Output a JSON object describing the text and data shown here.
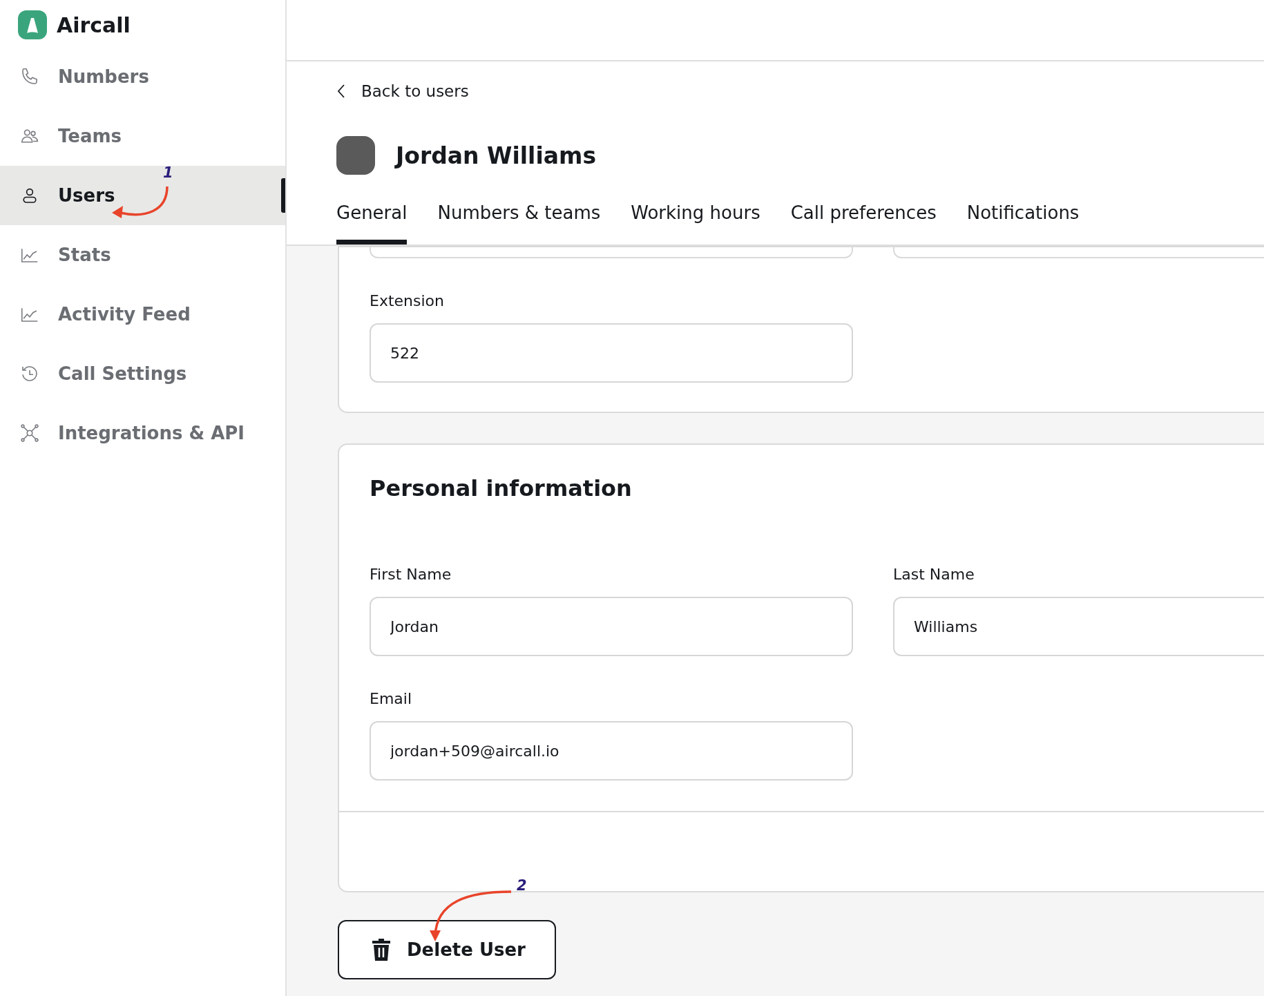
{
  "sidebar": {
    "brand": "Aircall",
    "items": [
      {
        "label": "Numbers",
        "selected": false
      },
      {
        "label": "Teams",
        "selected": false
      },
      {
        "label": "Users",
        "selected": true
      },
      {
        "label": "Stats",
        "selected": false
      },
      {
        "label": "Activity Feed",
        "selected": false
      },
      {
        "label": "Call Settings",
        "selected": false
      },
      {
        "label": "Integrations & API",
        "selected": false
      }
    ]
  },
  "back_link": "Back to users",
  "user": {
    "name": "Jordan Williams"
  },
  "tabs": [
    {
      "label": "General",
      "selected": true
    },
    {
      "label": "Numbers & teams",
      "selected": false
    },
    {
      "label": "Working hours",
      "selected": false
    },
    {
      "label": "Call preferences",
      "selected": false
    },
    {
      "label": "Notifications",
      "selected": false
    }
  ],
  "extension": {
    "label": "Extension",
    "value": "522"
  },
  "personal_information": {
    "title": "Personal information",
    "fields": [
      {
        "label": "First Name",
        "value": "Jordan"
      },
      {
        "label": "Last Name",
        "value": "Williams"
      },
      {
        "label": "Email",
        "value": "jordan+509@aircall.io"
      }
    ]
  },
  "delete_button": "Delete User",
  "annotations": [
    {
      "label": "1"
    },
    {
      "label": "2"
    }
  ]
}
